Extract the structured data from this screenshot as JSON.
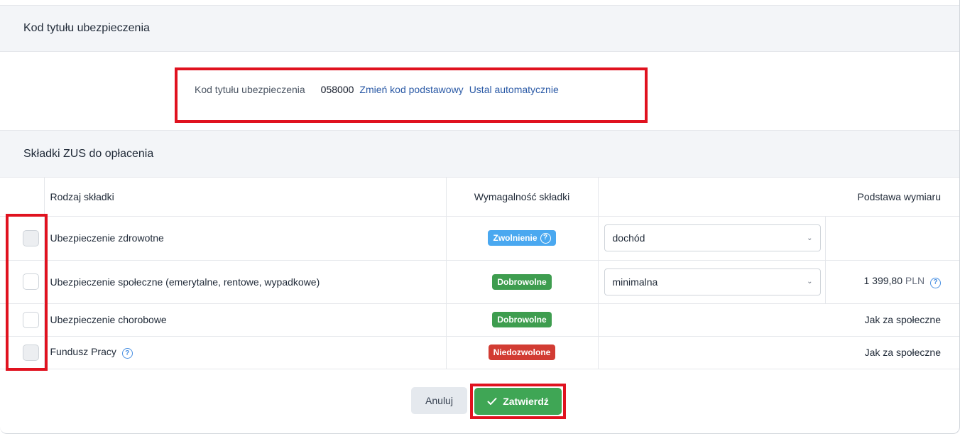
{
  "section1": {
    "title": "Kod tytułu ubezpieczenia"
  },
  "kod": {
    "label": "Kod tytułu ubezpieczenia",
    "value": "058000",
    "change_link": "Zmień kod podstawowy",
    "auto_link": "Ustal automatycznie"
  },
  "section2": {
    "title": "Składki ZUS do opłacenia"
  },
  "table": {
    "headers": {
      "type": "Rodzaj składki",
      "requirement": "Wymagalność składki",
      "base": "Podstawa wymiaru"
    },
    "rows": [
      {
        "type": "Ubezpieczenie zdrowotne",
        "badge": "Zwolnienie",
        "badge_color": "#4aa8f0",
        "select": "dochód",
        "base": "",
        "unit": ""
      },
      {
        "type": "Ubezpieczenie społeczne (emerytalne, rentowe, wypadkowe)",
        "badge": "Dobrowolne",
        "badge_color": "#3e9d4f",
        "select": "minimalna",
        "base": "1 399,80",
        "unit": "PLN"
      },
      {
        "type": "Ubezpieczenie chorobowe",
        "badge": "Dobrowolne",
        "badge_color": "#3e9d4f",
        "select": "",
        "base": "Jak za społeczne",
        "unit": ""
      },
      {
        "type": "Fundusz Pracy",
        "badge": "Niedozwolone",
        "badge_color": "#d23c33",
        "select": "",
        "base": "Jak za społeczne",
        "unit": ""
      }
    ]
  },
  "buttons": {
    "cancel": "Anuluj",
    "confirm": "Zatwierdź"
  },
  "icons": {
    "help": "question-circle-icon",
    "chevron": "chevron-down-icon",
    "check": "check-icon"
  },
  "colors": {
    "accent_link": "#2b5aa6",
    "highlight": "#e0121f",
    "confirm": "#3fa655"
  }
}
